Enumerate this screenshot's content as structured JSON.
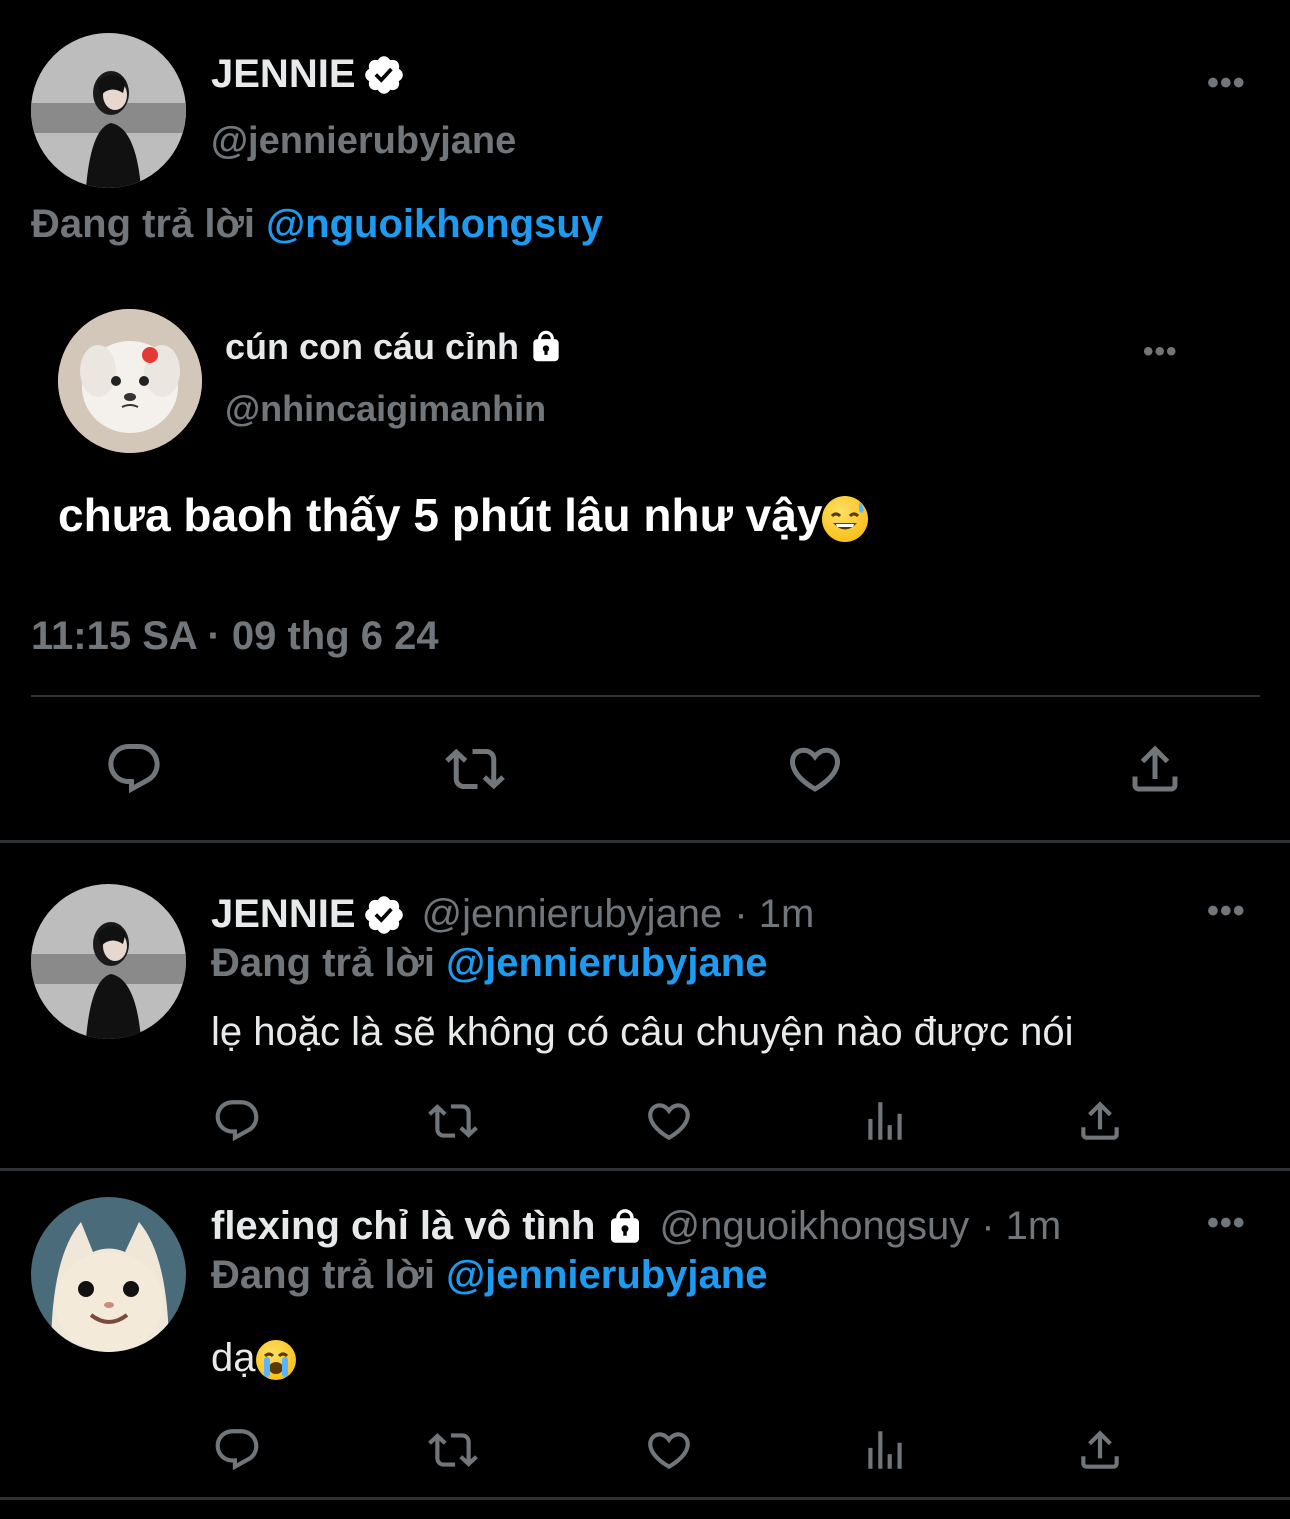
{
  "main_tweet": {
    "author_name": "JENNIE",
    "author_handle": "@jennierubyjane",
    "reply_prefix": "Đang trả lời",
    "reply_to": "@nguoikhongsuy"
  },
  "quoted_tweet": {
    "author_name": "cún con cáu cỉnh",
    "author_handle": "@nhincaigimanhin",
    "text": "chưa baoh thấy 5 phút lâu như vậy"
  },
  "timestamp": "11:15 SA · 09 thg 6 24",
  "replies": [
    {
      "author_name": "JENNIE",
      "author_handle": "@jennierubyjane",
      "time": "· 1m",
      "reply_prefix": "Đang trả lời",
      "reply_to": "@jennierubyjane",
      "text": "lẹ hoặc là sẽ không có câu chuyện nào được nói"
    },
    {
      "author_name": "flexing chỉ là vô tình",
      "author_handle": "@nguoikhongsuy",
      "time": "· 1m",
      "reply_prefix": "Đang trả lời",
      "reply_to": "@jennierubyjane",
      "text": "dạ"
    }
  ],
  "more_label": "•••",
  "colors": {
    "background": "#000000",
    "text": "#e7e9ea",
    "muted": "#71767b",
    "link": "#1d9bf0",
    "divider": "#2f3336"
  }
}
